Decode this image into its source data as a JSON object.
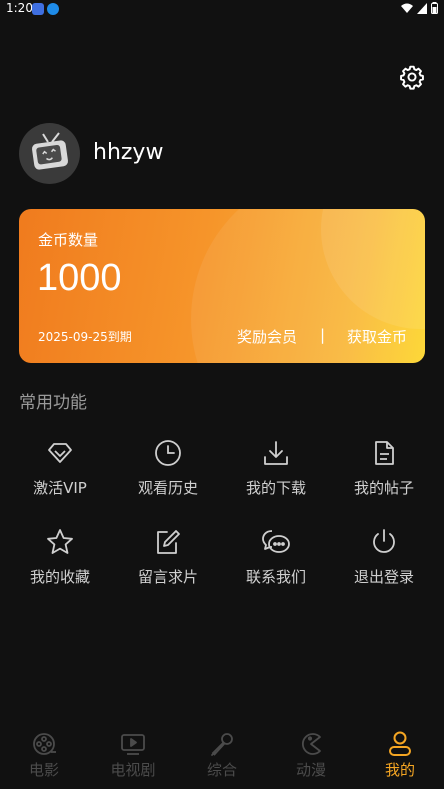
{
  "status_bar": {
    "time": "1:20"
  },
  "profile": {
    "username": "hhzyw"
  },
  "coin_card": {
    "label": "金币数量",
    "amount": "1000",
    "expire": "2025-09-25到期",
    "member_link": "奖励会员",
    "separator": "|",
    "coins_link": "获取金币"
  },
  "functions": {
    "title": "常用功能",
    "items": [
      {
        "label": "激活VIP",
        "icon": "diamond-icon"
      },
      {
        "label": "观看历史",
        "icon": "clock-icon"
      },
      {
        "label": "我的下载",
        "icon": "download-icon"
      },
      {
        "label": "我的帖子",
        "icon": "document-icon"
      },
      {
        "label": "我的收藏",
        "icon": "star-icon"
      },
      {
        "label": "留言求片",
        "icon": "edit-icon"
      },
      {
        "label": "联系我们",
        "icon": "chat-icon"
      },
      {
        "label": "退出登录",
        "icon": "power-icon"
      }
    ]
  },
  "bottom_nav": {
    "items": [
      {
        "label": "电影",
        "icon": "film-reel-icon"
      },
      {
        "label": "电视剧",
        "icon": "tv-play-icon"
      },
      {
        "label": "综合",
        "icon": "microphone-icon"
      },
      {
        "label": "动漫",
        "icon": "pacman-icon"
      },
      {
        "label": "我的",
        "icon": "user-icon",
        "active": true
      }
    ]
  },
  "colors": {
    "background": "#111111",
    "accent": "#f5a623",
    "card_start": "#f07b1e",
    "card_end": "#fdd52a",
    "nav_inactive": "#4b4b4b"
  }
}
